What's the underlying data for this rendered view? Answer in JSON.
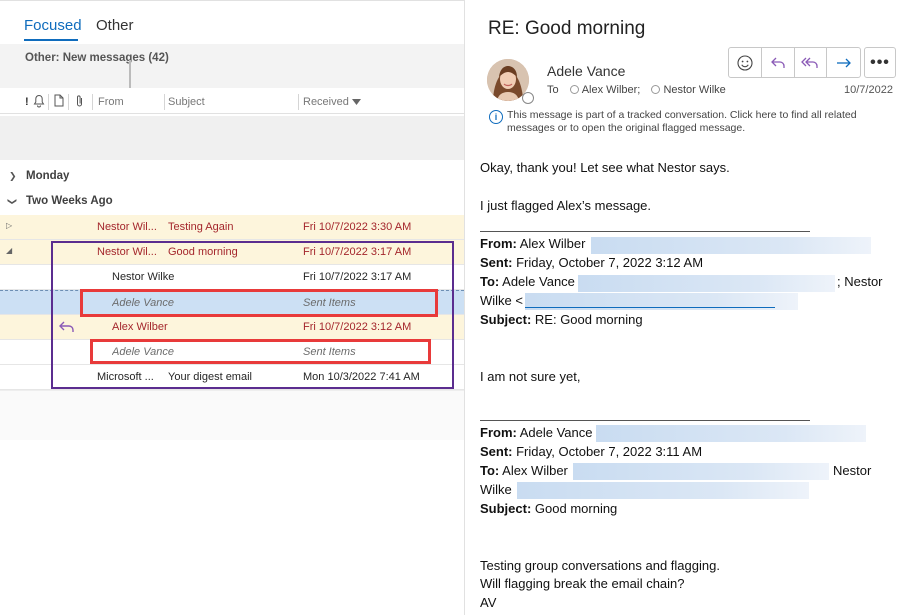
{
  "tabs": {
    "focused": "Focused",
    "other": "Other"
  },
  "other_bar": {
    "text": "Other: New messages (42)"
  },
  "columns": {
    "from": "From",
    "subject": "Subject",
    "received": "Received"
  },
  "groups": {
    "monday": "Monday",
    "two_weeks": "Two Weeks Ago"
  },
  "rows": [
    {
      "from": "Nestor Wil...",
      "subject": "Testing Again",
      "received": "Fri 10/7/2022 3:30 AM"
    },
    {
      "from": "Nestor Wil...",
      "subject": "Good morning",
      "received": "Fri 10/7/2022 3:17 AM"
    },
    {
      "from": "Nestor Wilke",
      "subject": "",
      "received": "Fri 10/7/2022 3:17 AM"
    },
    {
      "from": "Adele Vance",
      "subject": "",
      "received": "Sent Items"
    },
    {
      "from": "Alex Wilber",
      "subject": "",
      "received": "Fri 10/7/2022 3:12 AM"
    },
    {
      "from": "Adele Vance",
      "subject": "",
      "received": "Sent Items"
    },
    {
      "from": "Microsoft ...",
      "subject": "Your digest email",
      "received": "Mon 10/3/2022 7:41 AM"
    }
  ],
  "reading": {
    "subject": "RE: Good morning",
    "sender": "Adele Vance",
    "to_label": "To",
    "recipient1": "Alex Wilber;",
    "recipient2": "Nestor Wilke",
    "date": "10/7/2022",
    "info": "This message is part of a tracked conversation. Click here to find all related messages or to open the original flagged message.",
    "line1": "Okay, thank you! Let see what Nestor says.",
    "line2": "I just flagged Alex’s message.",
    "q1_from_label": "From:",
    "q1_from": " Alex Wilber",
    "q1_sent_label": "Sent:",
    "q1_sent": " Friday, October 7, 2022 3:12 AM",
    "q1_to_label": "To:",
    "q1_to": " Adele Vance",
    "q1_to_rest": "; Nestor",
    "q1_to_line2": "Wilke <",
    "q1_subject_label": "Subject:",
    "q1_subject": " RE: Good morning",
    "line3": "I am not sure yet,",
    "q2_from_label": "From:",
    "q2_from": " Adele Vance",
    "q2_sent_label": "Sent:",
    "q2_sent": " Friday, October 7, 2022 3:11 AM",
    "q2_to_label": "To:",
    "q2_to": " Alex Wilber",
    "q2_to_rest": "Nestor",
    "q2_to_line2": "Wilke",
    "q2_subject_label": "Subject:",
    "q2_subject": " Good morning",
    "line4": "Testing group conversations and flagging.",
    "line5": "Will flagging break the email chain?",
    "line6": "AV"
  },
  "toolbar": {
    "more": "•••"
  },
  "colors": {
    "accent": "#0f6cbd",
    "unread_red": "#a4262c",
    "highlight_red": "#e83a3a",
    "purple": "#5b2d8f"
  }
}
